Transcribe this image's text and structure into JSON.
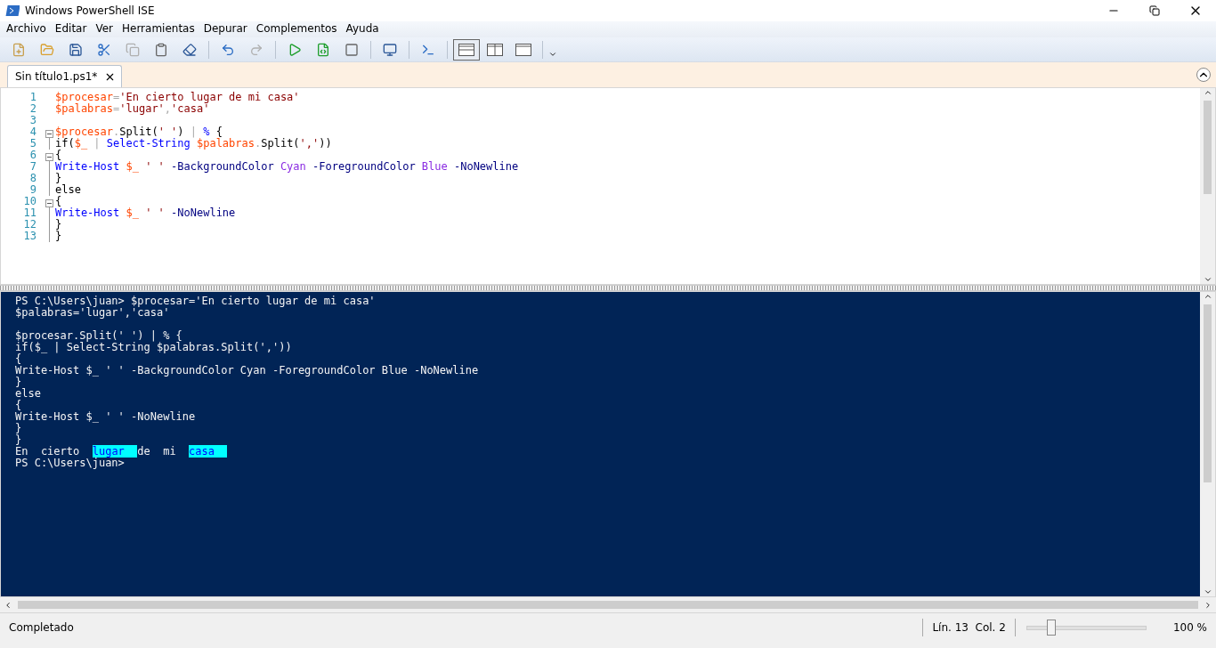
{
  "window": {
    "title": "Windows PowerShell ISE"
  },
  "menu": [
    "Archivo",
    "Editar",
    "Ver",
    "Herramientas",
    "Depurar",
    "Complementos",
    "Ayuda"
  ],
  "toolbar": {
    "buttons": [
      {
        "disabled": false
      },
      {
        "disabled": false
      },
      {
        "disabled": false
      },
      {
        "disabled": false
      },
      {
        "disabled": true
      },
      {
        "disabled": false
      },
      {
        "disabled": false
      },
      {
        "disabled": false
      },
      {
        "disabled": true
      },
      {
        "disabled": false
      },
      {
        "disabled": false
      },
      {
        "disabled": false
      },
      {
        "disabled": false
      },
      {
        "disabled": false
      }
    ],
    "layouts": [
      {
        "selected": true
      },
      {
        "selected": false
      },
      {
        "selected": false
      }
    ]
  },
  "tabs": [
    {
      "label": "Sin título1.ps1*",
      "selected": true
    }
  ],
  "editor": {
    "lines": [
      {
        "number": "1",
        "collapsible": false,
        "tokens": [
          {
            "kind": "var",
            "text": "$procesar"
          },
          {
            "kind": "op",
            "text": "="
          },
          {
            "kind": "str",
            "text": "'En cierto lugar de mi casa'"
          }
        ]
      },
      {
        "number": "2",
        "collapsible": false,
        "tokens": [
          {
            "kind": "var",
            "text": "$palabras"
          },
          {
            "kind": "op",
            "text": "="
          },
          {
            "kind": "str",
            "text": "'lugar'"
          },
          {
            "kind": "op",
            "text": ","
          },
          {
            "kind": "str",
            "text": "'casa'"
          }
        ]
      },
      {
        "number": "3",
        "collapsible": false
      },
      {
        "number": "4",
        "collapsible": true,
        "tokens": [
          {
            "kind": "var",
            "text": "$procesar"
          },
          {
            "kind": "op",
            "text": "."
          },
          {
            "kind": "plain",
            "text": "Split("
          },
          {
            "kind": "str",
            "text": "' '"
          },
          {
            "kind": "plain",
            "text": ")"
          },
          {
            "kind": "op",
            "text": " |"
          },
          {
            "kind": "cmd",
            "text": " %"
          },
          {
            "kind": "plain",
            "text": " {"
          }
        ]
      },
      {
        "number": "5",
        "collapsible": false,
        "tokens": [
          {
            "kind": "plain",
            "text": "if("
          },
          {
            "kind": "var",
            "text": "$_"
          },
          {
            "kind": "op",
            "text": " |"
          },
          {
            "kind": "cmd",
            "text": " Select-String"
          },
          {
            "kind": "var",
            "text": " $palabras"
          },
          {
            "kind": "op",
            "text": "."
          },
          {
            "kind": "plain",
            "text": "Split("
          },
          {
            "kind": "str",
            "text": "','"
          },
          {
            "kind": "plain",
            "text": "))"
          }
        ]
      },
      {
        "number": "6",
        "collapsible": true,
        "tokens": [
          {
            "kind": "plain",
            "text": "{"
          }
        ]
      },
      {
        "number": "7",
        "collapsible": false,
        "tokens": [
          {
            "kind": "cmd",
            "text": "Write-Host"
          },
          {
            "kind": "var",
            "text": " $_"
          },
          {
            "kind": "str",
            "text": " ' '"
          },
          {
            "kind": "param",
            "text": " -BackgroundColor"
          },
          {
            "kind": "arg",
            "text": " Cyan"
          },
          {
            "kind": "param",
            "text": " -ForegroundColor"
          },
          {
            "kind": "arg",
            "text": " Blue"
          },
          {
            "kind": "param",
            "text": " -NoNewline"
          }
        ]
      },
      {
        "number": "8",
        "collapsible": false,
        "tokens": [
          {
            "kind": "plain",
            "text": "}"
          }
        ]
      },
      {
        "number": "9",
        "collapsible": false,
        "tokens": [
          {
            "kind": "plain",
            "text": "else"
          }
        ]
      },
      {
        "number": "10",
        "collapsible": true,
        "tokens": [
          {
            "kind": "plain",
            "text": "{"
          }
        ]
      },
      {
        "number": "11",
        "collapsible": false,
        "tokens": [
          {
            "kind": "cmd",
            "text": "Write-Host"
          },
          {
            "kind": "var",
            "text": " $_"
          },
          {
            "kind": "str",
            "text": " ' '"
          },
          {
            "kind": "param",
            "text": " -NoNewline"
          }
        ]
      },
      {
        "number": "12",
        "collapsible": false,
        "tokens": [
          {
            "kind": "plain",
            "text": "}"
          }
        ]
      },
      {
        "number": "13",
        "collapsible": false,
        "tokens": [
          {
            "kind": "plain",
            "text": "}"
          }
        ]
      }
    ]
  },
  "console": {
    "lines": [
      {
        "space_before": false,
        "segments": [
          {
            "text": "PS C:\\Users\\juan> $procesar='En cierto lugar de mi casa'",
            "highlighted": false
          }
        ]
      },
      {
        "space_before": false,
        "segments": [
          {
            "text": "$palabras='lugar','casa'",
            "highlighted": false
          }
        ]
      },
      {
        "space_before": true,
        "segments": [
          {
            "text": "$procesar.Split(' ') | % {",
            "highlighted": false
          }
        ]
      },
      {
        "space_before": false,
        "segments": [
          {
            "text": "if($_ | Select-String $palabras.Split(','))",
            "highlighted": false
          }
        ]
      },
      {
        "space_before": false,
        "segments": [
          {
            "text": "{",
            "highlighted": false
          }
        ]
      },
      {
        "space_before": false,
        "segments": [
          {
            "text": "Write-Host $_ ' ' -BackgroundColor Cyan -ForegroundColor Blue -NoNewline",
            "highlighted": false
          }
        ]
      },
      {
        "space_before": false,
        "segments": [
          {
            "text": "}",
            "highlighted": false
          }
        ]
      },
      {
        "space_before": false,
        "segments": [
          {
            "text": "else",
            "highlighted": false
          }
        ]
      },
      {
        "space_before": false,
        "segments": [
          {
            "text": "{",
            "highlighted": false
          }
        ]
      },
      {
        "space_before": false,
        "segments": [
          {
            "text": "Write-Host $_ ' ' -NoNewline",
            "highlighted": false
          }
        ]
      },
      {
        "space_before": false,
        "segments": [
          {
            "text": "}",
            "highlighted": false
          }
        ]
      },
      {
        "space_before": false,
        "segments": [
          {
            "text": "}",
            "highlighted": false
          }
        ]
      },
      {
        "space_before": false,
        "segments": [
          {
            "text": "En  cierto  ",
            "highlighted": false
          },
          {
            "text": "lugar  ",
            "highlighted": true
          },
          {
            "text": "de  mi  ",
            "highlighted": false
          },
          {
            "text": "casa  ",
            "highlighted": true
          }
        ]
      },
      {
        "space_before": false,
        "segments": [
          {
            "text": "PS C:\\Users\\juan>",
            "highlighted": false
          }
        ]
      }
    ]
  },
  "status_bar": {
    "message": "Completado",
    "position": "Lín. 13  Col. 2",
    "zoom": {
      "level": 0.2,
      "reading": "100 %"
    }
  }
}
